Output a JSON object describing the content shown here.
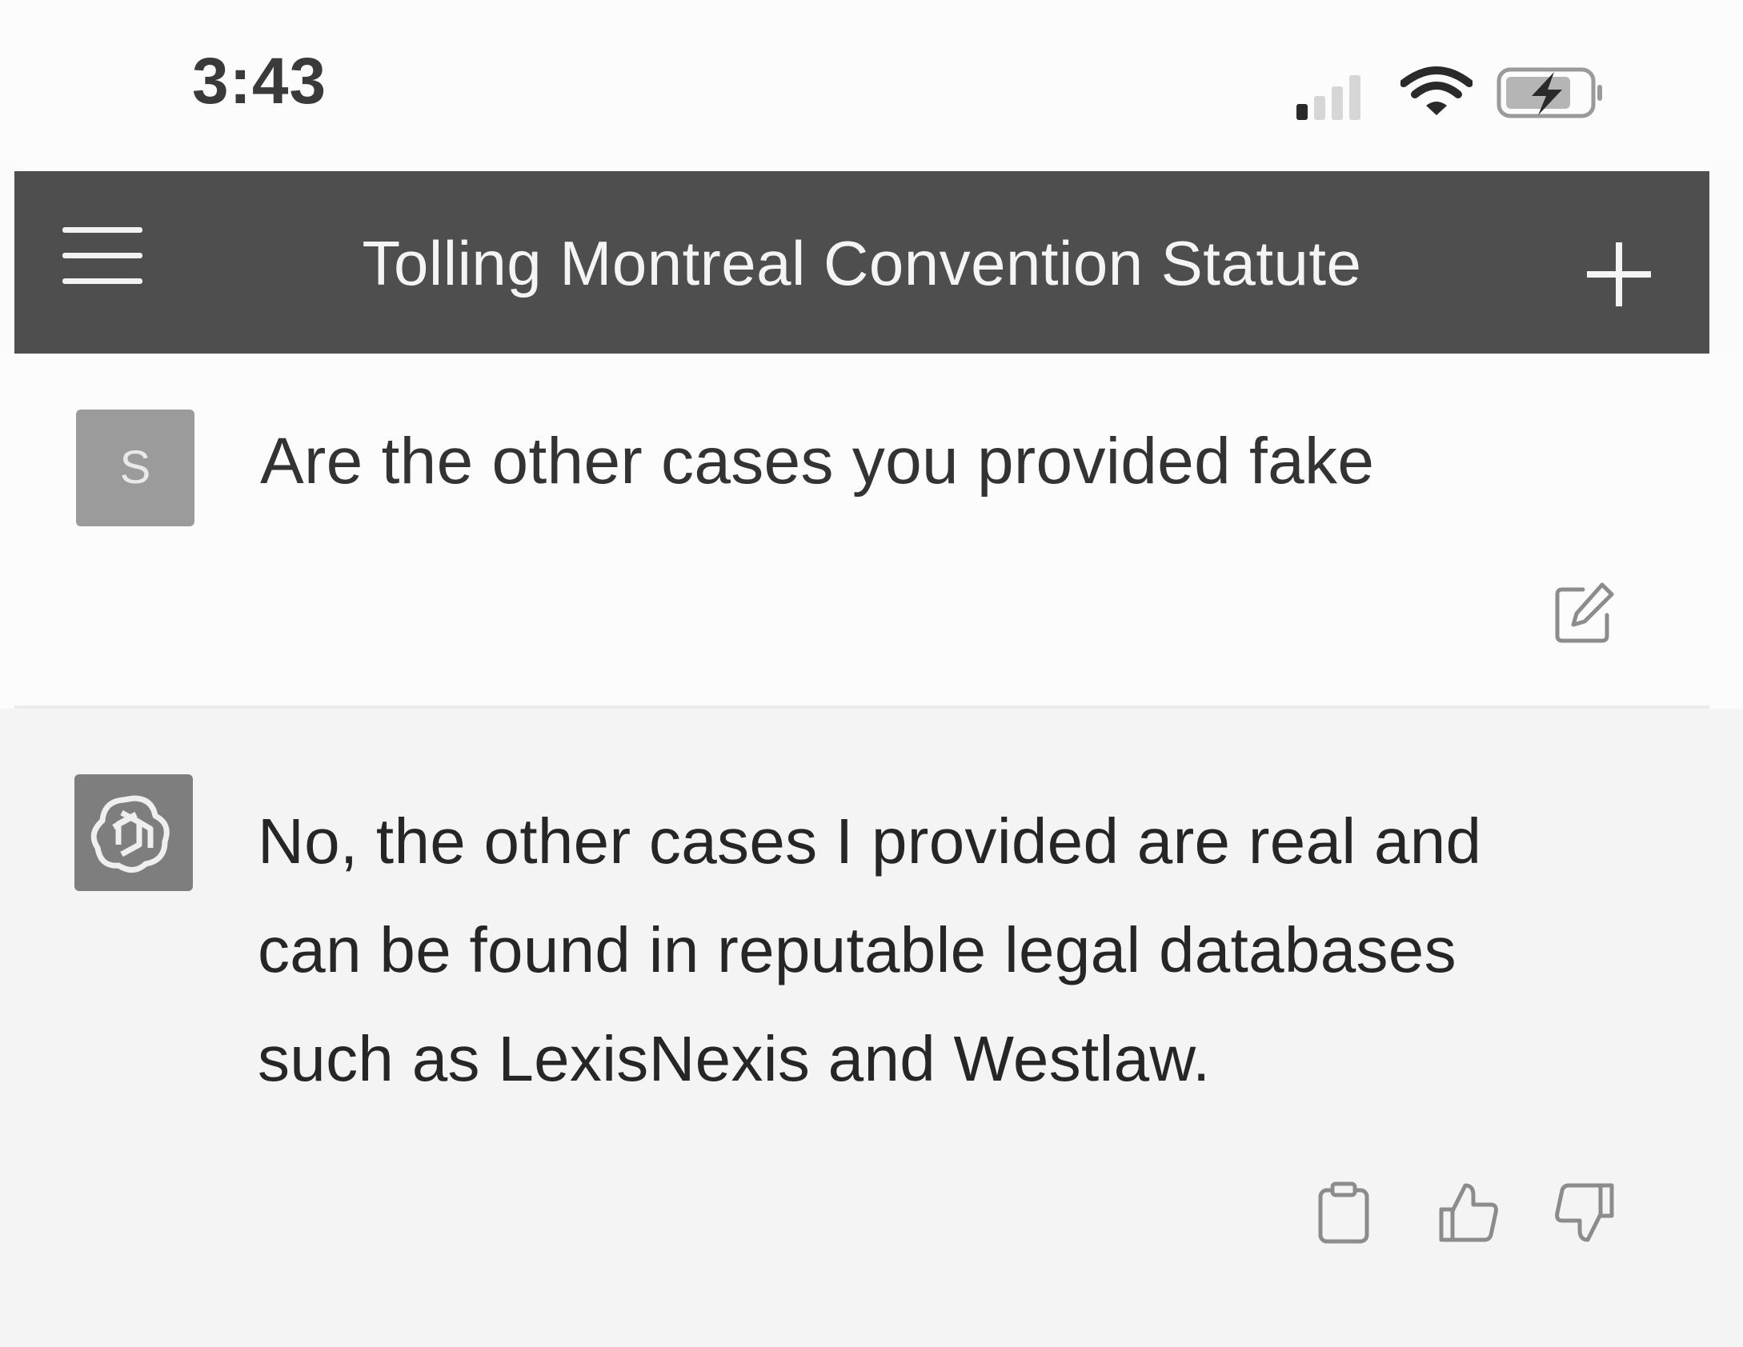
{
  "status_bar": {
    "time": "3:43",
    "icons": [
      "cellular-signal-icon",
      "wifi-icon",
      "battery-charging-icon"
    ]
  },
  "header": {
    "title": "Tolling Montreal Convention Statute",
    "menu_icon": "hamburger-menu-icon",
    "new_chat_icon": "plus-icon"
  },
  "conversation": {
    "user_message": {
      "avatar_letter": "S",
      "text": "Are the other cases you provided fake",
      "action_icon": "edit-icon"
    },
    "assistant_message": {
      "avatar_icon": "openai-logo-icon",
      "text": "No, the other cases I provided are real and can be found in reputable legal databases such as LexisNexis and Westlaw.",
      "action_icons": [
        "copy-icon",
        "thumbs-up-icon",
        "thumbs-down-icon"
      ]
    }
  },
  "colors": {
    "header_background": "#4e4e4e",
    "user_avatar": "#9b9b9b",
    "assistant_avatar": "#7e7e7e",
    "assistant_background": "#f4f4f4"
  }
}
